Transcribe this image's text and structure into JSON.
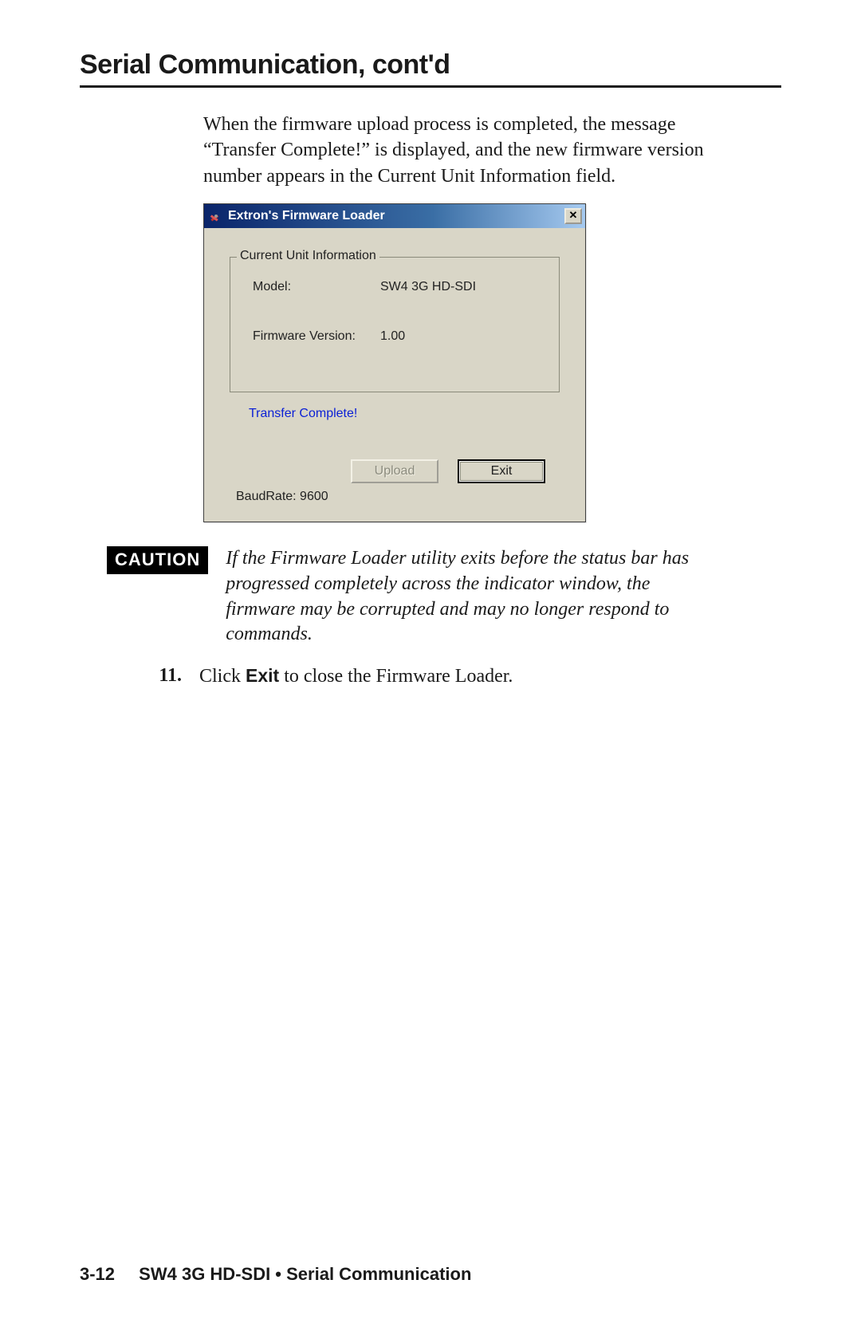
{
  "header": "Serial Communication, cont'd",
  "intro_para": "When the firmware upload process is completed, the message “Transfer Complete!” is displayed, and the new firmware version number appears in the Current Unit Information field.",
  "dialog": {
    "title": "Extron's Firmware Loader",
    "group_legend": "Current Unit Information",
    "model_label": "Model:",
    "model_value": "SW4 3G HD-SDI",
    "fw_label": "Firmware Version:",
    "fw_value": "1.00",
    "status": "Transfer Complete!",
    "upload_btn": "Upload",
    "exit_btn": "Exit",
    "baud": "BaudRate: 9600"
  },
  "caution": {
    "tag": "CAUTION",
    "text": "If the Firmware Loader utility exits before the status bar has progressed completely across the indicator window, the firmware may be corrupted and may no longer respond to commands."
  },
  "step": {
    "num": "11",
    "pre": "Click ",
    "bold": "Exit",
    "post": " to close the Firmware Loader."
  },
  "footer": {
    "page": "3-12",
    "text": "SW4 3G HD-SDI • Serial Communication"
  }
}
